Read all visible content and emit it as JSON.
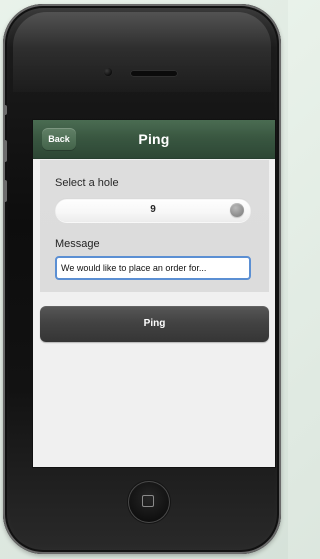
{
  "app": {
    "title": "Ping",
    "back_label": "Back"
  },
  "form": {
    "hole_label": "Select a hole",
    "hole_value": "9",
    "message_label": "Message",
    "message_value": "We would like to place an order for..."
  },
  "actions": {
    "ping_label": "Ping"
  },
  "icons": {
    "back": "back-arrow-icon",
    "slider_thumb": "slider-thumb-icon",
    "home": "home-square-icon",
    "camera": "front-camera-icon",
    "speaker": "speaker-icon"
  },
  "colors": {
    "navbar_green": "#2e4d36",
    "ping_button": "#434343",
    "input_focus": "#5b8fd3"
  }
}
